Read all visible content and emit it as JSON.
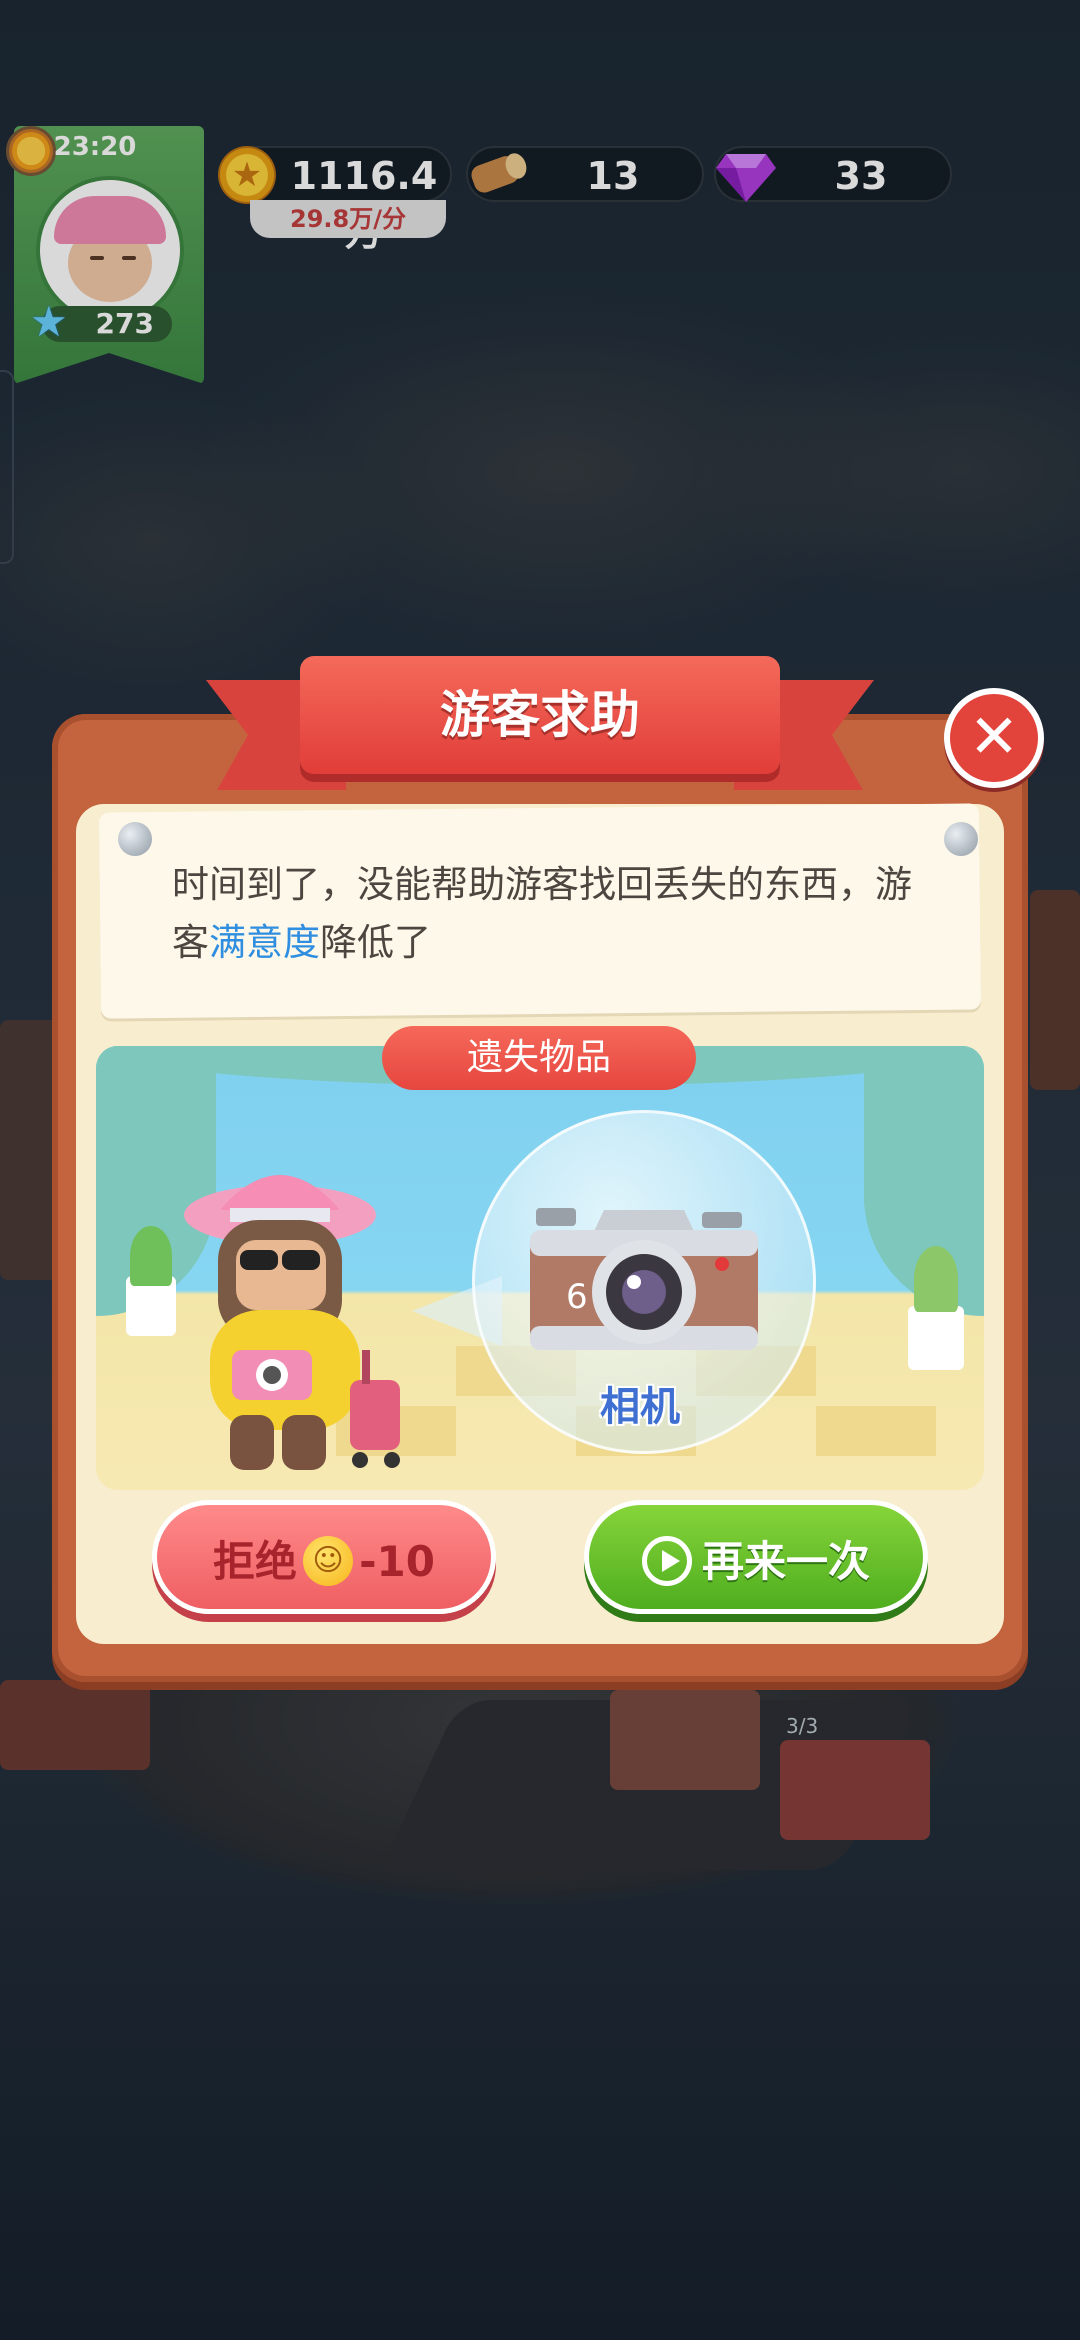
{
  "hud": {
    "time": "23:20",
    "level": "273",
    "coins": "1116.4万",
    "coin_rate": "29.8万/分",
    "wood": "13",
    "gems": "33"
  },
  "dialog": {
    "title": "游客求助",
    "close_symbol": "✕",
    "message_part1": "时间到了，没能帮助游客找回丢失的东西，游客",
    "message_highlight": "满意度",
    "message_part2": "降低了",
    "lost_items_label": "遗失物品",
    "item_name": "相机",
    "reject_label": "拒绝",
    "reject_penalty": "-10",
    "retry_label": "再来一次"
  },
  "map": {
    "shop_counter": "3/3"
  }
}
